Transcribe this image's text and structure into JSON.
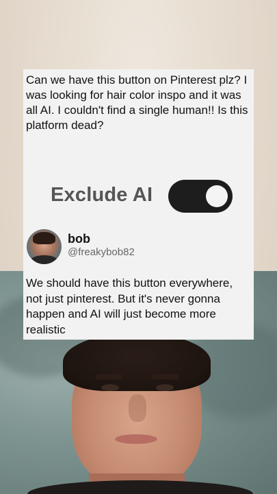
{
  "post": {
    "text": "Can we have this button on Pinterest plz? I was looking for hair color inspo and it was all AI. I couldn't find a single human!! Is this platform dead?"
  },
  "toggle": {
    "label": "Exclude AI",
    "state": "on"
  },
  "reply": {
    "user_name": "bob",
    "user_handle": "@freakybob82",
    "text": "We should have this button everywhere, not just pinterest. But it's never gonna happen and AI will just become more realistic"
  }
}
